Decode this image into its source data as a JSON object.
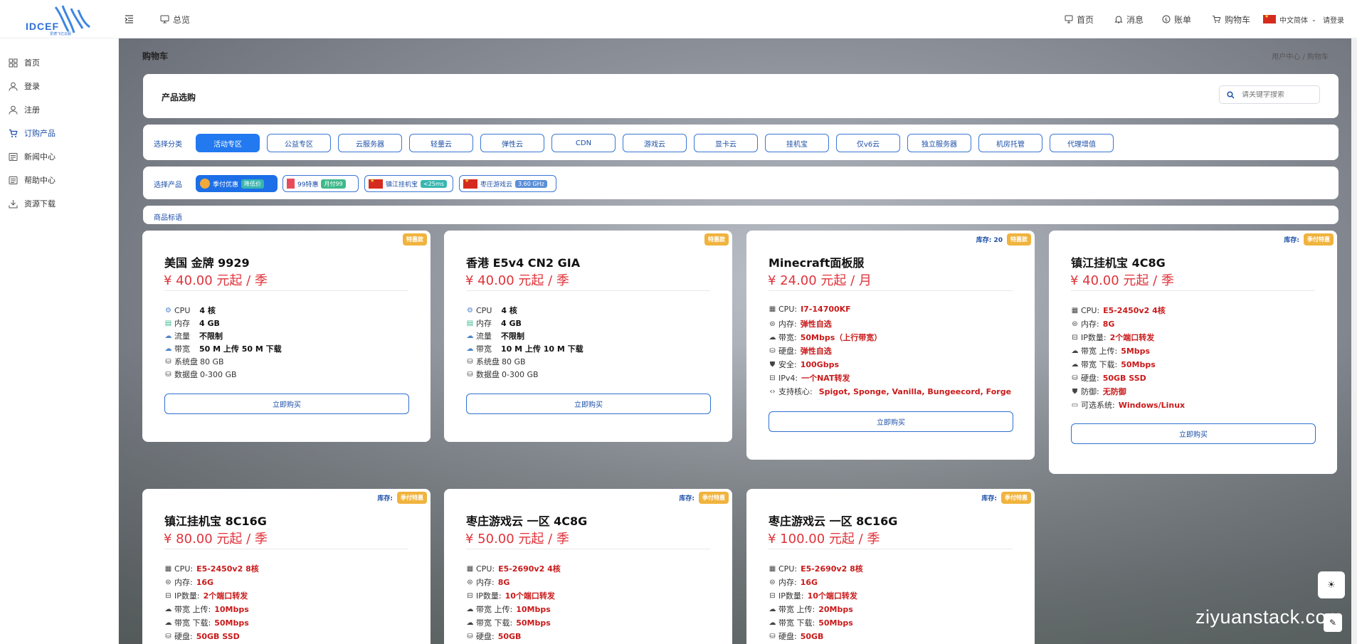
{
  "logo": {
    "text": "IDCEF",
    "subtitle": "爱德飞亿云服"
  },
  "topbar": {
    "menu_toggle_icon": "menu-fold-icon",
    "overview": "总览",
    "links": [
      {
        "label": "首页",
        "icon": "monitor-icon"
      },
      {
        "label": "消息",
        "icon": "bell-icon"
      },
      {
        "label": "账单",
        "icon": "dollar-icon"
      },
      {
        "label": "购物车",
        "icon": "cart-icon"
      }
    ],
    "language": "中文简体",
    "login": "请登录"
  },
  "sidebar": {
    "items": [
      {
        "label": "首页",
        "icon": "dashboard-icon"
      },
      {
        "label": "登录",
        "icon": "user-icon"
      },
      {
        "label": "注册",
        "icon": "user-add-icon"
      },
      {
        "label": "订购产品",
        "icon": "cart-icon"
      },
      {
        "label": "新闻中心",
        "icon": "news-icon"
      },
      {
        "label": "帮助中心",
        "icon": "help-doc-icon"
      },
      {
        "label": "资源下载",
        "icon": "download-icon"
      }
    ]
  },
  "page": {
    "title": "购物车",
    "breadcrumb": "用户中心 / 购物车"
  },
  "select_panel": {
    "title": "产品选购",
    "search_placeholder": "请关键字搜索"
  },
  "category_row": {
    "label": "选择分类",
    "items": [
      "活动专区",
      "公益专区",
      "云服务器",
      "轻量云",
      "弹性云",
      "CDN",
      "游戏云",
      "显卡云",
      "挂机宝",
      "仅v6云",
      "独立服务器",
      "机房托管",
      "代理增值"
    ],
    "active": "活动专区"
  },
  "product_row": {
    "label": "选择产品",
    "items": [
      {
        "name": "季付优惠",
        "badge": "降低价"
      },
      {
        "name": "99特惠",
        "badge": "月付99"
      },
      {
        "name": "镇江挂机宝",
        "badge": "<25ms"
      },
      {
        "name": "枣庄游戏云",
        "badge": "3.60 GHz"
      }
    ]
  },
  "tag_row": {
    "label": "商品标语"
  },
  "cards": [
    {
      "name": "美国 金牌 9929",
      "price": "¥ 40.00 元起 / 季",
      "badge": "特惠款",
      "stock": "",
      "specs": [
        {
          "k": "CPU",
          "v": "4 核",
          "icon": "cpu-icon"
        },
        {
          "k": "内存",
          "v": "4 GB",
          "icon": "memory-icon"
        },
        {
          "k": "流量",
          "v": "不限制",
          "icon": "traffic-icon"
        },
        {
          "k": "带宽",
          "v": "50 M 上传 50 M 下载",
          "icon": "bandwidth-icon"
        },
        {
          "k": "系统盘",
          "v": "80 GB",
          "icon": "disk-icon"
        },
        {
          "k": "数据盘",
          "v": "0-300 GB",
          "icon": "disk-icon"
        }
      ],
      "buy": "立即购买"
    },
    {
      "name": "香港 E5v4 CN2 GIA",
      "price": "¥ 40.00 元起 / 季",
      "badge": "特惠款",
      "stock": "",
      "specs": [
        {
          "k": "CPU",
          "v": "4 核",
          "icon": "cpu-icon"
        },
        {
          "k": "内存",
          "v": "4 GB",
          "icon": "memory-icon"
        },
        {
          "k": "流量",
          "v": "不限制",
          "icon": "traffic-icon"
        },
        {
          "k": "带宽",
          "v": "10 M 上传 10 M 下载",
          "icon": "bandwidth-icon"
        },
        {
          "k": "系统盘",
          "v": "80 GB",
          "icon": "disk-icon"
        },
        {
          "k": "数据盘",
          "v": "0-300 GB",
          "icon": "disk-icon"
        }
      ],
      "buy": "立即购买"
    },
    {
      "name": "Minecraft面板服",
      "price": "¥ 24.00 元起 / 月",
      "badge": "特惠款",
      "stock": "库存: 20",
      "specs": [
        {
          "k": "CPU:",
          "v": "I7-14700KF",
          "icon": "cpu-icon"
        },
        {
          "k": "内存:",
          "v": "弹性自选",
          "icon": "memory-icon"
        },
        {
          "k": "带宽:",
          "v": "50Mbps（上行带宽）",
          "icon": "cloud-icon"
        },
        {
          "k": "硬盘:",
          "v": "弹性自选",
          "icon": "disk-icon"
        },
        {
          "k": "安全:",
          "v": "100Gbps",
          "icon": "shield-icon"
        },
        {
          "k": "IPv4:",
          "v": "一个NAT转发",
          "icon": "ip-icon"
        },
        {
          "k": "支持核心:",
          "v": "Spigot, Sponge, Vanilla, Bungeecord, Forge",
          "icon": "code-icon"
        }
      ],
      "buy": "立即购买"
    },
    {
      "name": "镇江挂机宝 4C8G",
      "price": "¥ 40.00 元起 / 季",
      "badge": "季付特惠",
      "stock": "库存:",
      "specs": [
        {
          "k": "CPU:",
          "v": "E5-2450v2 4核",
          "icon": "cpu-icon"
        },
        {
          "k": "内存:",
          "v": "8G",
          "icon": "memory-icon"
        },
        {
          "k": "IP数量:",
          "v": "2个端口转发",
          "icon": "ip-icon"
        },
        {
          "k": "带宽 上传:",
          "v": "5Mbps",
          "icon": "cloud-icon"
        },
        {
          "k": "带宽 下载:",
          "v": "50Mbps",
          "icon": "cloud-icon"
        },
        {
          "k": "硬盘:",
          "v": "50GB SSD",
          "icon": "disk-icon"
        },
        {
          "k": "防御:",
          "v": "无防御",
          "icon": "shield-icon"
        },
        {
          "k": "可选系统:",
          "v": "Windows/Linux",
          "icon": "os-icon"
        }
      ],
      "buy": "立即购买"
    },
    {
      "name": "镇江挂机宝 8C16G",
      "price": "¥ 80.00 元起 / 季",
      "badge": "季付特惠",
      "stock": "库存:",
      "specs": [
        {
          "k": "CPU:",
          "v": "E5-2450v2 8核",
          "icon": "cpu-icon"
        },
        {
          "k": "内存:",
          "v": "16G",
          "icon": "memory-icon"
        },
        {
          "k": "IP数量:",
          "v": "2个端口转发",
          "icon": "ip-icon"
        },
        {
          "k": "带宽 上传:",
          "v": "10Mbps",
          "icon": "cloud-icon"
        },
        {
          "k": "带宽 下载:",
          "v": "50Mbps",
          "icon": "cloud-icon"
        },
        {
          "k": "硬盘:",
          "v": "50GB SSD",
          "icon": "disk-icon"
        }
      ],
      "buy": ""
    },
    {
      "name": "枣庄游戏云 一区 4C8G",
      "price": "¥ 50.00 元起 / 季",
      "badge": "季付特惠",
      "stock": "库存:",
      "specs": [
        {
          "k": "CPU:",
          "v": "E5-2690v2 4核",
          "icon": "cpu-icon"
        },
        {
          "k": "内存:",
          "v": "8G",
          "icon": "memory-icon"
        },
        {
          "k": "IP数量:",
          "v": "10个端口转发",
          "icon": "ip-icon"
        },
        {
          "k": "带宽 上传:",
          "v": "10Mbps",
          "icon": "cloud-icon"
        },
        {
          "k": "带宽 下载:",
          "v": "50Mbps",
          "icon": "cloud-icon"
        },
        {
          "k": "硬盘:",
          "v": "50GB",
          "icon": "disk-icon"
        }
      ],
      "buy": ""
    },
    {
      "name": "枣庄游戏云 一区 8C16G",
      "price": "¥ 100.00 元起 / 季",
      "badge": "季付特惠",
      "stock": "库存:",
      "specs": [
        {
          "k": "CPU:",
          "v": "E5-2690v2 8核",
          "icon": "cpu-icon"
        },
        {
          "k": "内存:",
          "v": "16G",
          "icon": "memory-icon"
        },
        {
          "k": "IP数量:",
          "v": "10个端口转发",
          "icon": "ip-icon"
        },
        {
          "k": "带宽 上传:",
          "v": "20Mbps",
          "icon": "cloud-icon"
        },
        {
          "k": "带宽 下载:",
          "v": "50Mbps",
          "icon": "cloud-icon"
        },
        {
          "k": "硬盘:",
          "v": "50GB",
          "icon": "disk-icon"
        }
      ],
      "buy": ""
    }
  ],
  "floating": {
    "theme_icon": "sun-icon",
    "edit_icon": "edit-icon"
  },
  "watermark": "ziyuanstack.com"
}
